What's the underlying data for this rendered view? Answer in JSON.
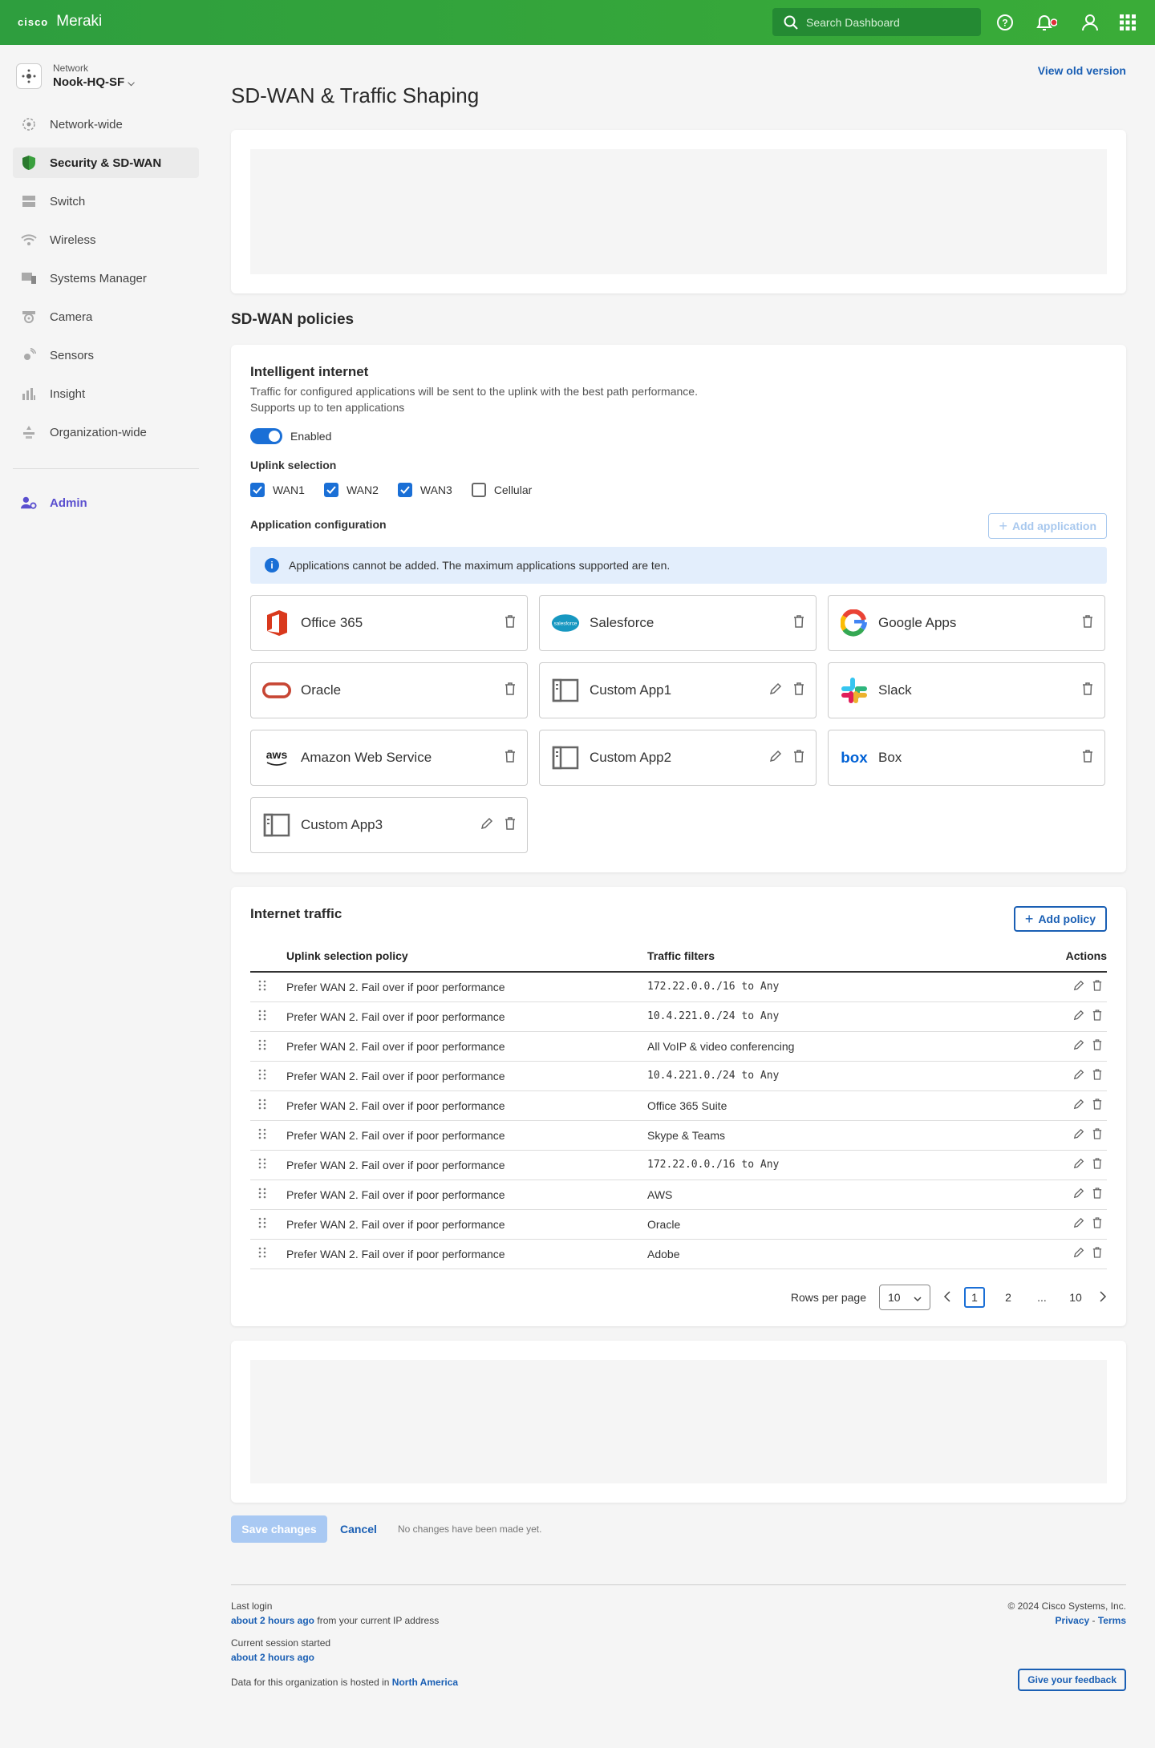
{
  "header": {
    "brand": "cisco",
    "product": "Meraki",
    "search_placeholder": "Search Dashboard",
    "icons": [
      "help-icon",
      "notification-bell-icon",
      "user-icon",
      "apps-grid-icon"
    ]
  },
  "sidebar": {
    "network_label": "Network",
    "network_name": "Nook-HQ-SF",
    "items": [
      {
        "label": "Network-wide",
        "icon": "network-wide-icon"
      },
      {
        "label": "Security & SD-WAN",
        "icon": "shield-icon"
      },
      {
        "label": "Switch",
        "icon": "switch-icon"
      },
      {
        "label": "Wireless",
        "icon": "wifi-icon"
      },
      {
        "label": "Systems Manager",
        "icon": "devices-icon"
      },
      {
        "label": "Camera",
        "icon": "camera-icon"
      },
      {
        "label": "Sensors",
        "icon": "sensor-icon"
      },
      {
        "label": "Insight",
        "icon": "bar-chart-icon"
      },
      {
        "label": "Organization-wide",
        "icon": "organization-icon"
      }
    ],
    "admin_label": "Admin"
  },
  "page": {
    "title": "SD-WAN & Traffic Shaping",
    "view_old": "View old version",
    "sdwan_title": "SD-WAN policies"
  },
  "intelligent": {
    "title": "Intelligent internet",
    "description": "Traffic for configured applications will be sent to the uplink with the best path performance. Supports up to ten applications",
    "toggle_label": "Enabled",
    "toggle_on": true,
    "uplink_label": "Uplink selection",
    "uplinks": [
      {
        "label": "WAN1",
        "checked": true
      },
      {
        "label": "WAN2",
        "checked": true
      },
      {
        "label": "WAN3",
        "checked": true
      },
      {
        "label": "Cellular",
        "checked": false
      }
    ],
    "app_config_label": "Application configuration",
    "add_app": "Add application",
    "info": "Applications cannot be added. The maximum applications supported are ten.",
    "apps": [
      {
        "name": "Office 365",
        "icon": "office365-logo",
        "editable": false
      },
      {
        "name": "Salesforce",
        "icon": "salesforce-logo",
        "editable": false
      },
      {
        "name": "Google Apps",
        "icon": "google-logo",
        "editable": false
      },
      {
        "name": "Oracle",
        "icon": "oracle-logo",
        "editable": false
      },
      {
        "name": "Custom App1",
        "icon": "custom-app-icon",
        "editable": true
      },
      {
        "name": "Slack",
        "icon": "slack-logo",
        "editable": false
      },
      {
        "name": "Amazon Web Service",
        "icon": "aws-logo",
        "editable": false
      },
      {
        "name": "Custom App2",
        "icon": "custom-app-icon",
        "editable": true
      },
      {
        "name": "Box",
        "icon": "box-logo",
        "editable": false
      },
      {
        "name": "Custom App3",
        "icon": "custom-app-icon",
        "editable": true
      }
    ]
  },
  "traffic": {
    "title": "Internet traffic",
    "add_policy": "Add policy",
    "columns": [
      "Uplink selection policy",
      "Traffic filters",
      "Actions"
    ],
    "rows": [
      {
        "policy": "Prefer WAN 2. Fail over if poor performance",
        "filter": "172.22.0.0./16 to Any",
        "mono": true
      },
      {
        "policy": "Prefer WAN 2. Fail over if poor performance",
        "filter": "10.4.221.0./24 to Any",
        "mono": true
      },
      {
        "policy": "Prefer WAN 2. Fail over if poor performance",
        "filter": "All VoIP & video conferencing",
        "mono": false
      },
      {
        "policy": "Prefer WAN 2. Fail over if poor performance",
        "filter": "10.4.221.0./24 to Any",
        "mono": true
      },
      {
        "policy": "Prefer WAN 2. Fail over if poor performance",
        "filter": "Office 365 Suite",
        "mono": false
      },
      {
        "policy": "Prefer WAN 2. Fail over if poor performance",
        "filter": "Skype & Teams",
        "mono": false
      },
      {
        "policy": "Prefer WAN 2. Fail over if poor performance",
        "filter": "172.22.0.0./16 to Any",
        "mono": true
      },
      {
        "policy": "Prefer WAN 2. Fail over if poor performance",
        "filter": "AWS",
        "mono": false
      },
      {
        "policy": "Prefer WAN 2. Fail over if poor performance",
        "filter": "Oracle",
        "mono": false
      },
      {
        "policy": "Prefer WAN 2. Fail over if poor performance",
        "filter": "Adobe",
        "mono": false
      }
    ],
    "rows_per_page_label": "Rows per page",
    "rows_per_page": "10",
    "pages": [
      "1",
      "2",
      "...",
      "10"
    ],
    "current_page": "1"
  },
  "actions": {
    "save": "Save changes",
    "cancel": "Cancel",
    "status": "No changes have been made yet."
  },
  "footer": {
    "last_login_label": "Last login",
    "last_login_value": "about 2 hours ago",
    "last_login_suffix": "from your current IP address",
    "session_label": "Current session started",
    "session_value": "about 2 hours ago",
    "hosted_prefix": "Data for this organization is hosted in",
    "hosted_region": "North America",
    "copyright": "© 2024 Cisco Systems, Inc.",
    "privacy": "Privacy",
    "separator": "-",
    "terms": "Terms",
    "feedback": "Give your feedback"
  }
}
